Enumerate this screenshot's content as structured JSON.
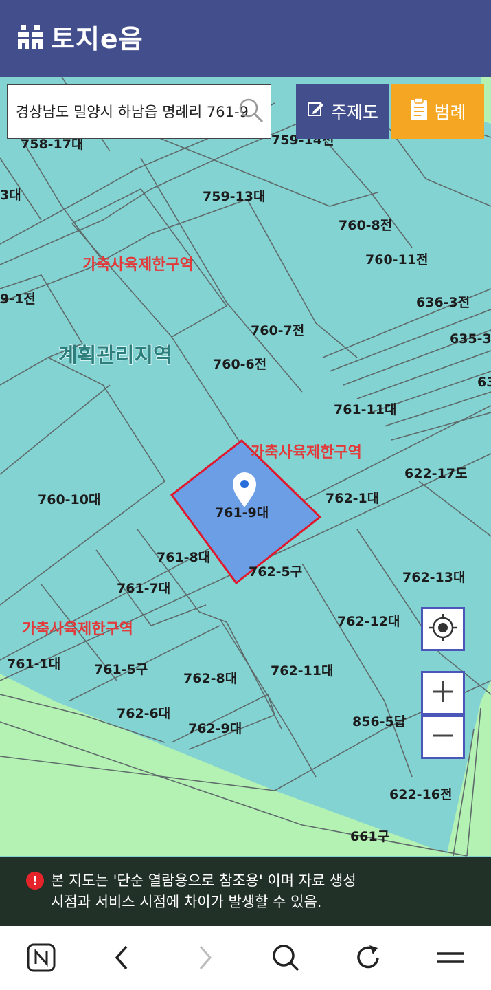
{
  "header": {
    "logo_text": "토지e음"
  },
  "search": {
    "value": "경상남도 밀양시 하남읍 명례리 761-9"
  },
  "buttons": {
    "theme_label": "주제도",
    "legend_label": "범례"
  },
  "map": {
    "area_label": "계획관리지역",
    "zone_labels": [
      "가축사육제한구역",
      "가축사육제한구역",
      "가축사육제한구역"
    ],
    "selected_parcel": "761-9대",
    "parcels": [
      "758-17대",
      "759-14전",
      "759-13대",
      "760-8전",
      "760-11전",
      "636-3전",
      "760-7전",
      "760-6전",
      "635-3",
      "63",
      "761-11대",
      "622-17도",
      "760-10대",
      "762-1대",
      "761-8대",
      "762-5구",
      "762-13대",
      "761-7대",
      "762-12대",
      "761-1대",
      "761-5구",
      "762-8대",
      "762-11대",
      "762-6대",
      "762-9대",
      "856-5답",
      "622-16전",
      "661구",
      "9-1전",
      "3대"
    ],
    "colors": {
      "land": "#84d3d3",
      "green_zone": "#b4f2b4",
      "selected_fill": "#6c9ee6",
      "selected_border": "#e0182c",
      "zone_text": "#e23a3a"
    }
  },
  "controls": {
    "locate_icon": "crosshair-icon",
    "zoom_in_icon": "plus-icon",
    "zoom_out_icon": "minus-icon"
  },
  "notice": {
    "icon": "!",
    "text_line1": "본 지도는 '단순 열람용으로 참조용' 이며 자료 생성",
    "text_line2": "시점과 서비스 시점에 차이가 발생할 수 있음."
  },
  "browser_nav": {
    "icons": [
      "naver-icon",
      "back-icon",
      "forward-icon",
      "search-icon",
      "refresh-icon",
      "menu-icon"
    ]
  }
}
